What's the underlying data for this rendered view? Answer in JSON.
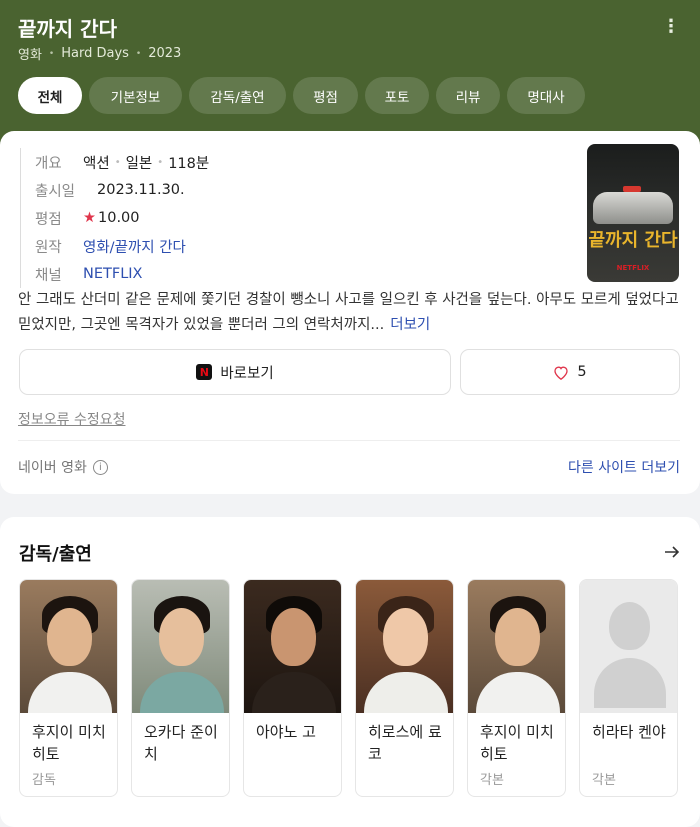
{
  "header": {
    "title": "끝까지 간다",
    "category": "영화",
    "english_title": "Hard Days",
    "year": "2023",
    "tabs": [
      "전체",
      "기본정보",
      "감독/출연",
      "평점",
      "포토",
      "리뷰",
      "명대사"
    ]
  },
  "info": {
    "overview_label": "개요",
    "genre": "액션",
    "country": "일본",
    "runtime": "118분",
    "release_label": "출시일",
    "release_date": "2023.11.30.",
    "rating_label": "평점",
    "rating": "10.00",
    "original_label": "원작",
    "original": "영화/끝까지 간다",
    "channel_label": "채널",
    "channel": "NETFLIX"
  },
  "poster": {
    "title": "끝까지 간다",
    "brand": "NETFLIX"
  },
  "synopsis": {
    "text": "안 그래도 산더미 같은 문제에 쫓기던 경찰이 뺑소니 사고를 일으킨 후 사건을 덮는다. 아무도 모르게 덮었다고 믿었지만, 그곳엔 목격자가 있었을 뿐더러 그의 연락처까지...",
    "more_label": "더보기"
  },
  "actions": {
    "watch_label": "바로보기",
    "like_count": "5"
  },
  "footer": {
    "report_label": "정보오류 수정요청",
    "source_label": "네이버 영화",
    "other_sites_label": "다른 사이트 더보기"
  },
  "cast_section": {
    "title": "감독/출연",
    "people": [
      {
        "name": "후지이 미치히토",
        "role": "감독"
      },
      {
        "name": "오카다 준이치",
        "role": ""
      },
      {
        "name": "아야노 고",
        "role": ""
      },
      {
        "name": "히로스에 료코",
        "role": ""
      },
      {
        "name": "후지이 미치히토",
        "role": "각본"
      },
      {
        "name": "히라타 켄야",
        "role": "각본"
      }
    ]
  },
  "colors": {
    "header_bg": "#4a6330",
    "link": "#2e4fb0",
    "star": "#e0364c"
  }
}
